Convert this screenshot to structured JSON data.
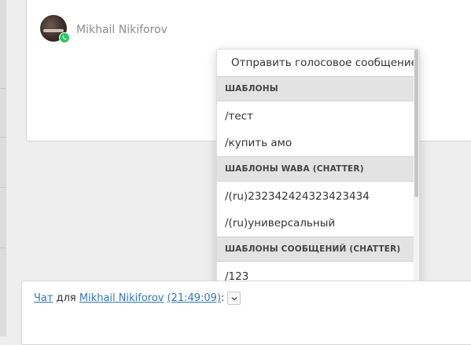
{
  "feed": {
    "author_name": "Mikhail Nikiforov",
    "channel_icon": "whatsapp-icon"
  },
  "dropdown": {
    "voice_label": "Отправить голосовое сообщение",
    "sections": [
      {
        "title": "ШАБЛОНЫ",
        "items": [
          "/тест",
          "/купить амо"
        ]
      },
      {
        "title": "ШАБЛОНЫ WABA (CHATTER)",
        "items": [
          "/(ru)232342424323423434",
          "/(ru)универсальный"
        ]
      },
      {
        "title": "ШАБЛОНЫ СООБЩЕНИЙ (CHATTER)",
        "items": [
          "/123"
        ]
      }
    ]
  },
  "composer": {
    "chat_link": "Чат",
    "for_text": " для ",
    "user_link": "Mikhail Nikiforov",
    "time_link": "(21:49:09)",
    "colon": ":"
  },
  "colors": {
    "link": "#2d77c2",
    "whatsapp": "#29c660"
  }
}
